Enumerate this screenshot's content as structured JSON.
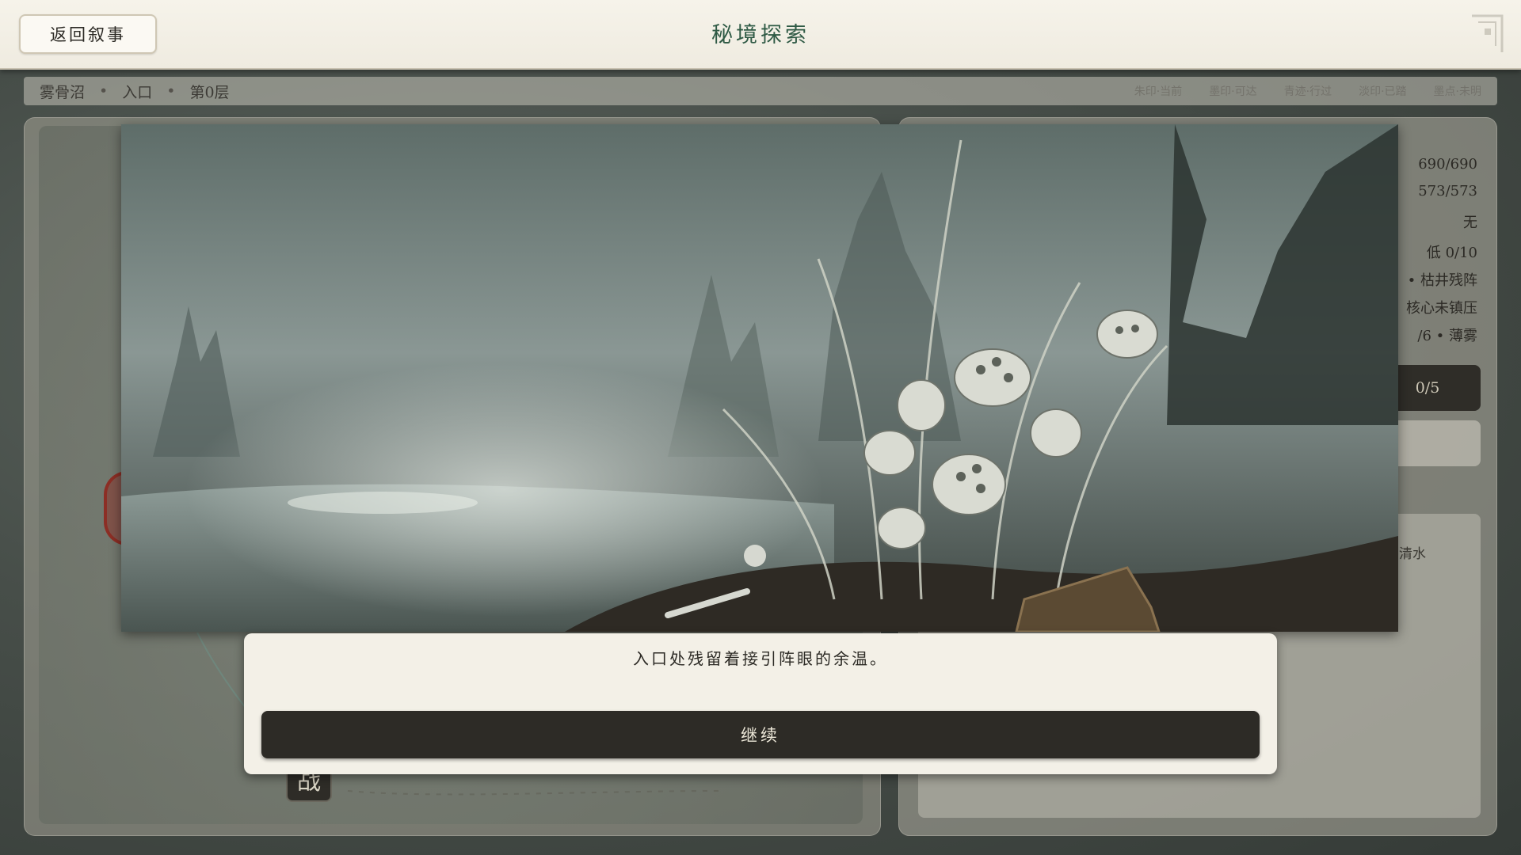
{
  "header": {
    "back_label": "返回叙事",
    "title": "秘境探索"
  },
  "location": {
    "area": "雾骨沼",
    "point": "入口",
    "floor": "第0层",
    "separator": "•",
    "legend": [
      "朱印·当前",
      "墨印·可达",
      "青迹·行过",
      "淡印·已踏",
      "墨点·未明"
    ]
  },
  "stats": {
    "hp": "690/690",
    "qi": "573/573",
    "status": "无",
    "danger": "低 0/10",
    "formation": "• 枯井残阵",
    "core": "核心未镇压",
    "fog": "/6 • 薄雾",
    "action_button": "0/5",
    "info_text": "井清水"
  },
  "map": {
    "battle_node_label": "战"
  },
  "event": {
    "scene_name": "misty-swamp-illustration",
    "text": "入口处残留着接引阵眼的余温。",
    "continue_label": "继续"
  },
  "colors": {
    "title_green": "#2f5a45",
    "dark_button": "#2d2b26",
    "parchment": "#f3f0e7"
  }
}
